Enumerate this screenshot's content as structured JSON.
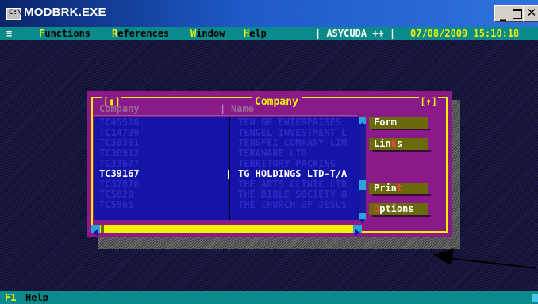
{
  "window": {
    "title": "MODBRK.EXE",
    "sys_icon": "C:\\"
  },
  "menubar": {
    "system": "≡",
    "items": [
      {
        "hot": "F",
        "rest": "unctions"
      },
      {
        "hot": "R",
        "rest": "eferences"
      },
      {
        "hot": "W",
        "rest": "indow"
      },
      {
        "hot": "H",
        "rest": "elp"
      }
    ],
    "app": "| ASYCUDA ++ |",
    "datetime": "07/08/2009 15:10:18"
  },
  "dialog": {
    "title": "Company",
    "corner_left": "[▮]",
    "corner_right": "[↑]",
    "headers": {
      "col1": "Company",
      "col2": "Name"
    },
    "rows": [
      {
        "code": "TC45588",
        "name": "TEN GB ENTERPRISES"
      },
      {
        "code": "TC14799",
        "name": "TENGEL INVESTMENT L"
      },
      {
        "code": "TC38391",
        "name": "TENGFEI COMPANY LIM"
      },
      {
        "code": "TC30912",
        "name": "TERAWARE LTD"
      },
      {
        "code": "TC33677",
        "name": "TERRITORY PACKING"
      },
      {
        "code": "TC39167",
        "name": "TG HOLDINGS LTD-T/A",
        "selected": true
      },
      {
        "code": "TC37070",
        "name": "THE ARTS CLINIC LTD"
      },
      {
        "code": "TC5020",
        "name": "THE BIBLE SOCIETY O"
      },
      {
        "code": "TC5965",
        "name": "THE CHURCH OF JESUS"
      }
    ],
    "buttons": {
      "form": {
        "pre": "Form",
        "hot": "",
        "post": ""
      },
      "links": {
        "pre": "Lin",
        "hot": "k",
        "post": "s"
      },
      "print": {
        "pre": "Prin",
        "hot": "t",
        "post": ""
      },
      "options": {
        "pre": "",
        "hot": "O",
        "post": "ptions"
      }
    }
  },
  "status": {
    "key": "F1",
    "label": "Help"
  },
  "colors": {
    "menu_bg": "#0a8a8a",
    "dialog_bg": "#8a1a8a",
    "list_bg": "#1414a8",
    "accent": "#f0f000"
  }
}
